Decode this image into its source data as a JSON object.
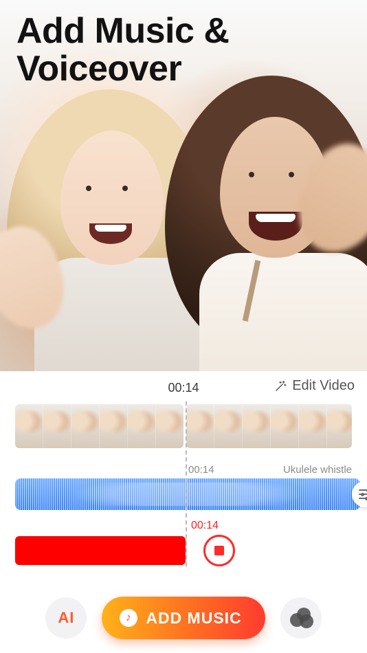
{
  "hero": {
    "title_line1": "Add Music &",
    "title_line2": "Voiceover"
  },
  "timeline": {
    "current_time": "00:14",
    "edit_video_label": "Edit Video"
  },
  "music": {
    "start_time": "00:14",
    "track_name": "Ukulele whistle"
  },
  "voiceover": {
    "current_time": "00:14"
  },
  "toolbar": {
    "ai_label": "AI",
    "add_music_label": "ADD MUSIC"
  },
  "icons": {
    "wand": "magic-wand-icon",
    "sliders": "sliders-icon",
    "record": "record-stop-icon",
    "note": "music-note-icon",
    "filters": "color-filters-icon"
  },
  "colors": {
    "accent_orange": "#ff5a2e",
    "record_red": "#ff1e1e",
    "music_blue": "#3f86f5"
  }
}
